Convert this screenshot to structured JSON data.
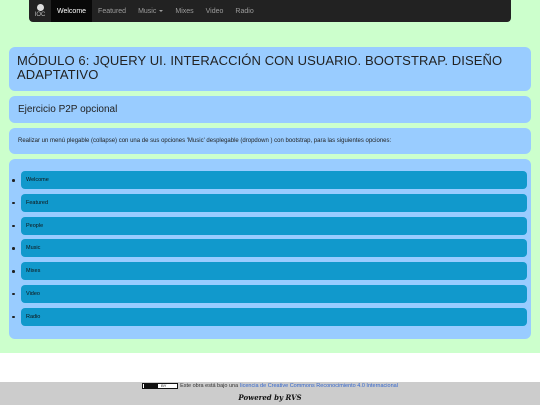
{
  "navbar": {
    "brand_text": "IOC",
    "items": [
      {
        "label": "Welcome"
      },
      {
        "label": "Featured"
      },
      {
        "label": "Music"
      },
      {
        "label": "Mixes"
      },
      {
        "label": "Video"
      },
      {
        "label": "Radio"
      }
    ]
  },
  "main": {
    "title": "MÓDULO 6: JQUERY UI. INTERACCIÓN CON USUARIO. BOOTSTRAP. DISEÑO ADAPTATIVO",
    "subtitle": "Ejercicio P2P opcional",
    "description": "Realizar un menú plegable (collapse) con una de sus opciones 'Music' desplegable (dropdown ) con bootstrap, para las siguientes opciones:",
    "options": [
      {
        "label": "Welcome"
      },
      {
        "label": "Featured"
      },
      {
        "label": "People"
      },
      {
        "label": "Music"
      },
      {
        "label": "Mixes"
      },
      {
        "label": "Video"
      },
      {
        "label": "Radio"
      }
    ]
  },
  "footer": {
    "badge_text": "BY",
    "license_prefix": "Este obra está bajo una",
    "license_link": "licencia de Creative Commons Reconocimiento 4.0 Internacional",
    "powered_by": "Powered by RVS"
  },
  "colors": {
    "page_background": "#ccffcc",
    "panel_background": "#99ccff",
    "option_background": "#1199cc",
    "navbar_background": "#222222",
    "footer_background": "#cccccc"
  }
}
